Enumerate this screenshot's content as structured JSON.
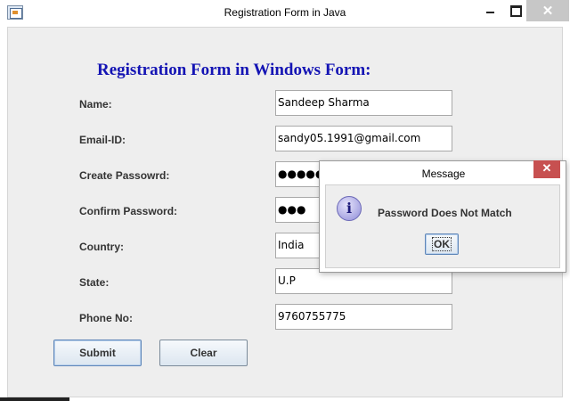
{
  "window": {
    "title": "Registration Form in Java",
    "close_glyph": "✕"
  },
  "form": {
    "heading": "Registration Form in Windows Form:",
    "fields": [
      {
        "label": "Name:",
        "value": "Sandeep Sharma"
      },
      {
        "label": "Email-ID:",
        "value": "sandy05.1991@gmail.com"
      },
      {
        "label": "Create Passowrd:",
        "value": "●●●●●●"
      },
      {
        "label": "Confirm Password:",
        "value": "●●●"
      },
      {
        "label": "Country:",
        "value": "India"
      },
      {
        "label": "State:",
        "value": "U.P"
      },
      {
        "label": "Phone No:",
        "value": "9760755775"
      }
    ],
    "submit_label": "Submit",
    "clear_label": "Clear"
  },
  "dialog": {
    "title": "Message",
    "close_glyph": "✕",
    "icon": "info-icon",
    "icon_glyph": "i",
    "message": "Password Does Not Match",
    "ok_label": "OK"
  }
}
